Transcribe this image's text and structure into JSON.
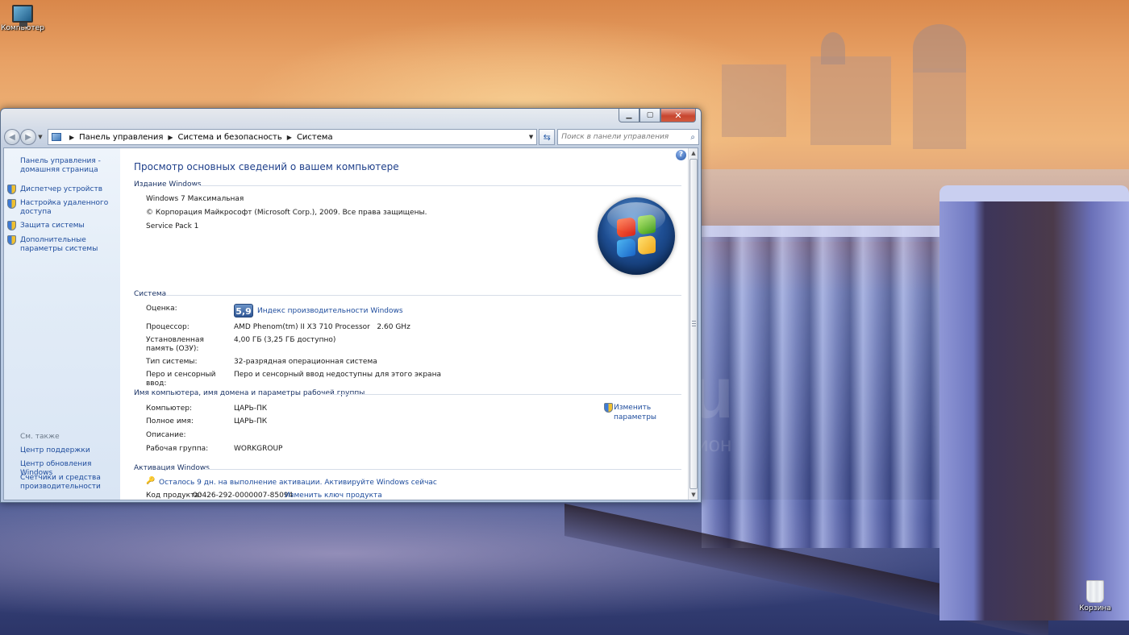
{
  "desktop": {
    "icons": [
      {
        "label": "Компьютер",
        "icon": "computer-icon"
      },
      {
        "label": "Корзина",
        "icon": "recycle-bin-icon"
      }
    ],
    "watermark": {
      "line1": "au.ru",
      "line2": "интернет-аукцион"
    }
  },
  "window": {
    "caption_buttons": [
      "minimize",
      "maximize",
      "close"
    ],
    "breadcrumb": [
      "Панель управления",
      "Система и безопасность",
      "Система"
    ],
    "search_placeholder": "Поиск в панели управления",
    "sidebar": {
      "home_link": "Панель управления - домашняя страница",
      "tasks": [
        "Диспетчер устройств",
        "Настройка удаленного доступа",
        "Защита системы",
        "Дополнительные параметры системы"
      ],
      "see_also_heading": "См. также",
      "see_also": [
        "Центр поддержки",
        "Центр обновления Windows",
        "Счетчики и средства производительности"
      ]
    },
    "main": {
      "title": "Просмотр основных сведений о вашем компьютере",
      "edition": {
        "heading": "Издание Windows",
        "name": "Windows 7 Максимальная",
        "copyright": "© Корпорация Майкрософт (Microsoft Corp.), 2009. Все права защищены.",
        "service_pack": "Service Pack 1"
      },
      "system": {
        "heading": "Система",
        "rating_label": "Оценка:",
        "rating_score": "5,9",
        "rating_link": "Индекс производительности Windows",
        "processor_label": "Процессор:",
        "processor_value": "AMD Phenom(tm) II X3 710 Processor   2.60 GHz",
        "memory_label": "Установленная память (ОЗУ):",
        "memory_value": "4,00 ГБ (3,25 ГБ доступно)",
        "type_label": "Тип системы:",
        "type_value": "32-разрядная операционная система",
        "pen_label": "Перо и сенсорный ввод:",
        "pen_value": "Перо и сенсорный ввод недоступны для этого экрана"
      },
      "computer_name": {
        "heading": "Имя компьютера, имя домена и параметры рабочей группы",
        "computer_label": "Компьютер:",
        "computer_value": "ЦАРЬ-ПК",
        "full_name_label": "Полное имя:",
        "full_name_value": "ЦАРЬ-ПК",
        "description_label": "Описание:",
        "description_value": "",
        "workgroup_label": "Рабочая группа:",
        "workgroup_value": "WORKGROUP",
        "change_link_line1": "Изменить",
        "change_link_line2": "параметры"
      },
      "activation": {
        "heading": "Активация Windows",
        "status_link": "Осталось 9 дн. на выполнение активации. Активируйте Windows сейчас",
        "product_key_label": "Код продукта:",
        "product_key_value": "00426-292-0000007-85094",
        "change_key_link": "Изменить ключ продукта"
      }
    }
  }
}
